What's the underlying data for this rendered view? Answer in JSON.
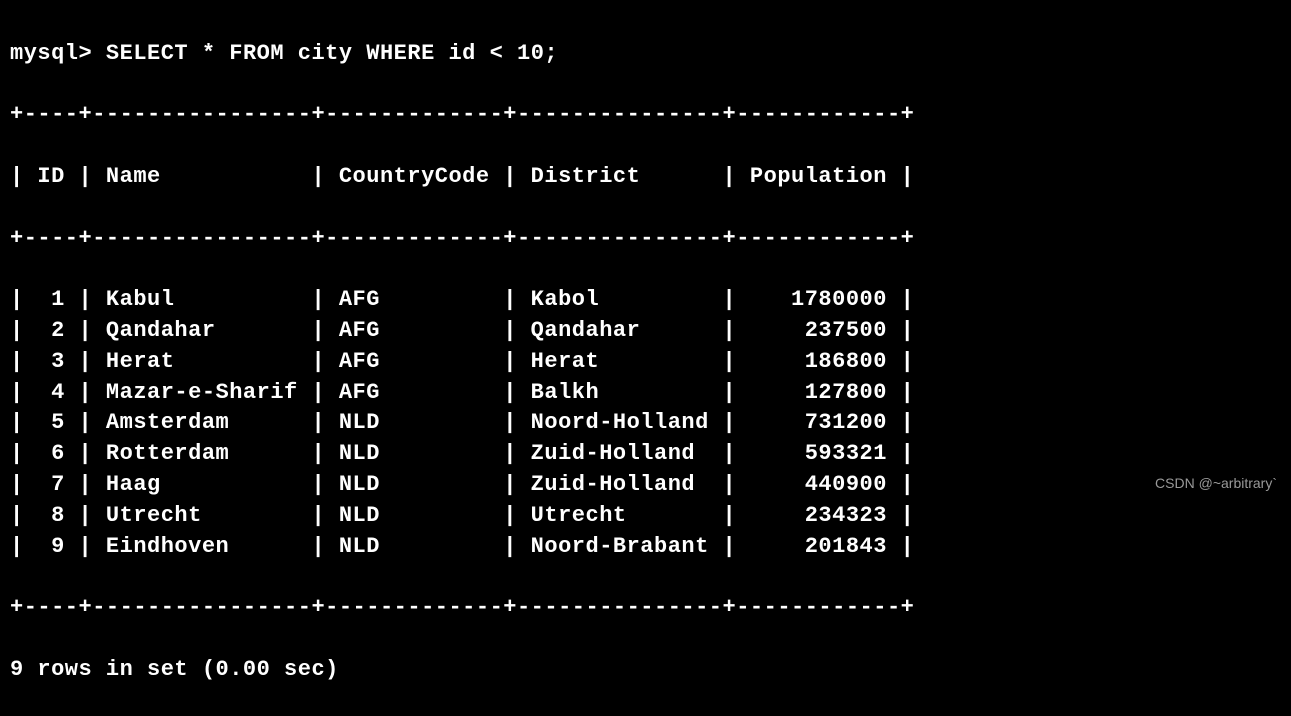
{
  "prompt": "mysql>",
  "query": "SELECT * FROM city WHERE id < 10;",
  "border_top": "+----+----------------+-------------+---------------+------------+",
  "header_line": "| ID | Name           | CountryCode | District      | Population |",
  "rows": [
    {
      "id": 1,
      "name": "Kabul",
      "country": "AFG",
      "district": "Kabol",
      "population": 1780000
    },
    {
      "id": 2,
      "name": "Qandahar",
      "country": "AFG",
      "district": "Qandahar",
      "population": 237500
    },
    {
      "id": 3,
      "name": "Herat",
      "country": "AFG",
      "district": "Herat",
      "population": 186800
    },
    {
      "id": 4,
      "name": "Mazar-e-Sharif",
      "country": "AFG",
      "district": "Balkh",
      "population": 127800
    },
    {
      "id": 5,
      "name": "Amsterdam",
      "country": "NLD",
      "district": "Noord-Holland",
      "population": 731200
    },
    {
      "id": 6,
      "name": "Rotterdam",
      "country": "NLD",
      "district": "Zuid-Holland",
      "population": 593321
    },
    {
      "id": 7,
      "name": "Haag",
      "country": "NLD",
      "district": "Zuid-Holland",
      "population": 440900
    },
    {
      "id": 8,
      "name": "Utrecht",
      "country": "NLD",
      "district": "Utrecht",
      "population": 234323
    },
    {
      "id": 9,
      "name": "Eindhoven",
      "country": "NLD",
      "district": "Noord-Brabant",
      "population": 201843
    }
  ],
  "footer": "9 rows in set (0.00 sec)",
  "watermark": "CSDN @~arbitrary`",
  "col_widths": {
    "id": 2,
    "name": 14,
    "country": 11,
    "district": 13,
    "population": 10
  },
  "chart_data": {
    "type": "table",
    "title": "SELECT * FROM city WHERE id < 10;",
    "columns": [
      "ID",
      "Name",
      "CountryCode",
      "District",
      "Population"
    ],
    "rows": [
      [
        1,
        "Kabul",
        "AFG",
        "Kabol",
        1780000
      ],
      [
        2,
        "Qandahar",
        "AFG",
        "Qandahar",
        237500
      ],
      [
        3,
        "Herat",
        "AFG",
        "Herat",
        186800
      ],
      [
        4,
        "Mazar-e-Sharif",
        "AFG",
        "Balkh",
        127800
      ],
      [
        5,
        "Amsterdam",
        "NLD",
        "Noord-Holland",
        731200
      ],
      [
        6,
        "Rotterdam",
        "NLD",
        "Zuid-Holland",
        593321
      ],
      [
        7,
        "Haag",
        "NLD",
        "Zuid-Holland",
        440900
      ],
      [
        8,
        "Utrecht",
        "NLD",
        "Utrecht",
        234323
      ],
      [
        9,
        "Eindhoven",
        "NLD",
        "Noord-Brabant",
        201843
      ]
    ]
  }
}
